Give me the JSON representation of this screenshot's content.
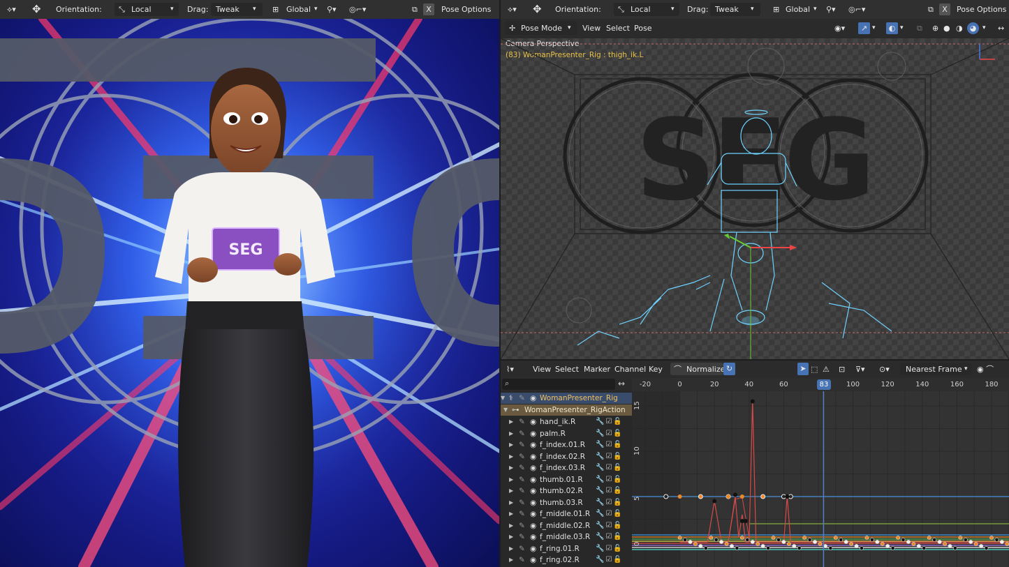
{
  "left_header": {
    "orientation_label": "Orientation:",
    "orientation_value": "Local",
    "drag_label": "Drag:",
    "drag_value": "Tweak",
    "pivot_value": "Global",
    "pose_options": "Pose Options",
    "x_label": "X"
  },
  "right_header": {
    "orientation_label": "Orientation:",
    "orientation_value": "Local",
    "drag_label": "Drag:",
    "drag_value": "Tweak",
    "pivot_value": "Global",
    "pose_options": "Pose Options",
    "x_label": "X"
  },
  "viewport_header": {
    "mode": "Pose Mode",
    "menu_view": "View",
    "menu_select": "Select",
    "menu_pose": "Pose"
  },
  "viewport": {
    "camera_label": "Camera Perspective",
    "active_info": "(83) WomanPresenter_Rig : thigh_ik.L"
  },
  "graph_header": {
    "menu_view": "View",
    "menu_select": "Select",
    "menu_marker": "Marker",
    "menu_channel": "Channel",
    "menu_key": "Key",
    "normalize": "Normalize",
    "snap_mode": "Nearest Frame"
  },
  "graph": {
    "current_frame": "83",
    "frame_ticks": [
      "-20",
      "0",
      "20",
      "40",
      "60",
      "100",
      "120",
      "140",
      "160",
      "180"
    ],
    "value_ticks": [
      "15",
      "10",
      "5",
      "0"
    ],
    "rig_name": "WomanPresenter_Rig",
    "action_name": "WomanPresenter_RigAction",
    "channels": [
      "hand_ik.R",
      "palm.R",
      "f_index.01.R",
      "f_index.02.R",
      "f_index.03.R",
      "thumb.01.R",
      "thumb.02.R",
      "thumb.03.R",
      "f_middle.01.R",
      "f_middle.02.R",
      "f_middle.03.R",
      "f_ring.01.R",
      "f_ring.02.R"
    ]
  },
  "render": {
    "card_logo": "SEG"
  },
  "colors": {
    "header_bg": "#303030",
    "active_blue": "#4772b3",
    "frame_line": "#5680c2",
    "keyframe_orange": "#e8892a",
    "curve_red": "#d83c3c"
  }
}
